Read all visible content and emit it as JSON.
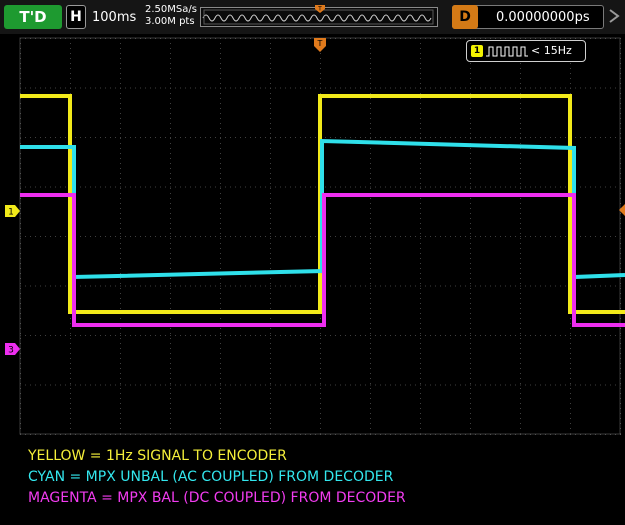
{
  "status_bar": {
    "trigger_status": "T'D",
    "horizontal_label": "H",
    "timebase": "100ms",
    "sample_rate": "2.50MSa/s",
    "memory_depth": "3.00M pts",
    "delay_label": "D",
    "delay_value": "0.00000000ps"
  },
  "trigger": {
    "channel_badge": "1",
    "frequency": "< 15Hz",
    "type_icon": "pulse-train-icon"
  },
  "markers": {
    "ch1": "1",
    "ch3": "3",
    "trigger": "T"
  },
  "colors": {
    "ch1": "#f2ea1a",
    "ch2": "#2fe0ea",
    "ch3": "#ee2ef0",
    "trigger_marker": "#e07a1c",
    "status_green": "#1e9a30"
  },
  "caption": {
    "yellow": "YELLOW = 1Hz SIGNAL TO ENCODER",
    "cyan": "CYAN = MPX UNBAL (AC COUPLED) FROM DECODER",
    "magenta": "MAGENTA = MPX BAL (DC COUPLED) FROM DECODER"
  }
}
